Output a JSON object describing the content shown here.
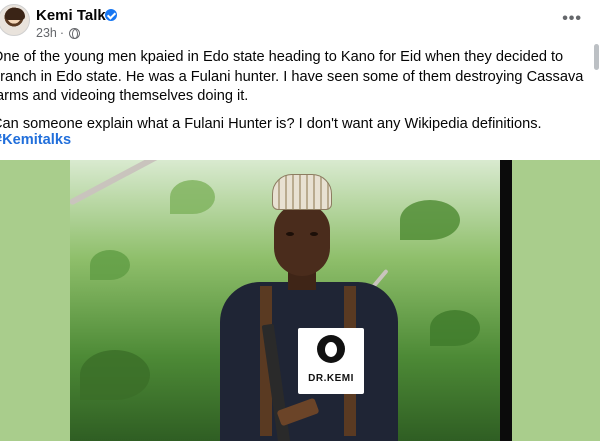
{
  "post": {
    "author": "Kemi Talks",
    "time": "23h",
    "paragraphs": [
      "One of the young men kpaied in Edo state heading to Kano for Eid when they decided to branch in Edo state. He was a Fulani hunter. I have seen some of them destroying Cassava farms and videoing themselves doing it.",
      "Can someone explain what a Fulani Hunter is? I don't want any Wikipedia definitions."
    ],
    "hashtag": "#Kemitalks",
    "more_label": "•••"
  },
  "media": {
    "watermark_text": "DR.KEMI"
  },
  "colors": {
    "accent": "#1877f2",
    "hashtag": "#216fdb",
    "meta": "#65676b",
    "media_bg": "#a9cd8c"
  },
  "icons": [
    "verified-badge-icon",
    "globe-icon",
    "more-options-icon"
  ]
}
